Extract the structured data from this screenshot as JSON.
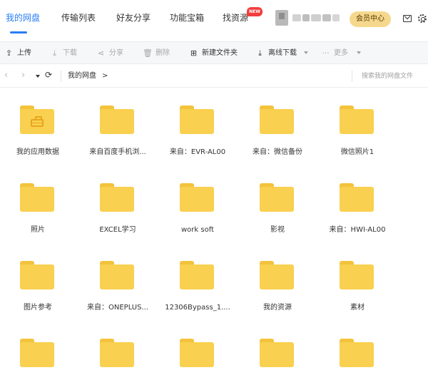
{
  "nav": {
    "tabs": [
      "我的网盘",
      "传输列表",
      "好友分享",
      "功能宝箱",
      "找资源"
    ],
    "active_tab": "我的网盘",
    "new_badge": "NEW",
    "vip_label": "会员中心"
  },
  "toolbar": {
    "upload": "上传",
    "download": "下载",
    "share": "分享",
    "delete": "删除",
    "new_folder": "新建文件夹",
    "offline_download": "离线下载",
    "more": "更多"
  },
  "address": {
    "breadcrumb": "我的网盘",
    "separator": ">",
    "search_placeholder": "搜索我的网盘文件"
  },
  "files": [
    {
      "name": "我的应用数据",
      "type": "app-folder"
    },
    {
      "name": "来自百度手机浏...",
      "type": "folder"
    },
    {
      "name": "来自：EVR-AL00",
      "type": "folder"
    },
    {
      "name": "来自：微信备份",
      "type": "folder"
    },
    {
      "name": "微信照片1",
      "type": "folder"
    },
    {
      "name": "照片",
      "type": "folder"
    },
    {
      "name": "EXCEL学习",
      "type": "folder"
    },
    {
      "name": "work soft",
      "type": "folder"
    },
    {
      "name": "影视",
      "type": "folder"
    },
    {
      "name": "来自：HWI-AL00",
      "type": "folder"
    },
    {
      "name": "图片参考",
      "type": "folder"
    },
    {
      "name": "来自：ONEPLUS...",
      "type": "folder"
    },
    {
      "name": "12306Bypass_1....",
      "type": "folder"
    },
    {
      "name": "我的资源",
      "type": "folder"
    },
    {
      "name": "素材",
      "type": "folder"
    },
    {
      "name": "",
      "type": "folder"
    },
    {
      "name": "",
      "type": "folder"
    },
    {
      "name": "",
      "type": "folder"
    },
    {
      "name": "",
      "type": "folder"
    },
    {
      "name": "",
      "type": "folder"
    }
  ],
  "colors": {
    "accent": "#2a7df4",
    "folder": "#f9d04f",
    "vip": "#f6d88d",
    "badge": "#f23d3d"
  }
}
